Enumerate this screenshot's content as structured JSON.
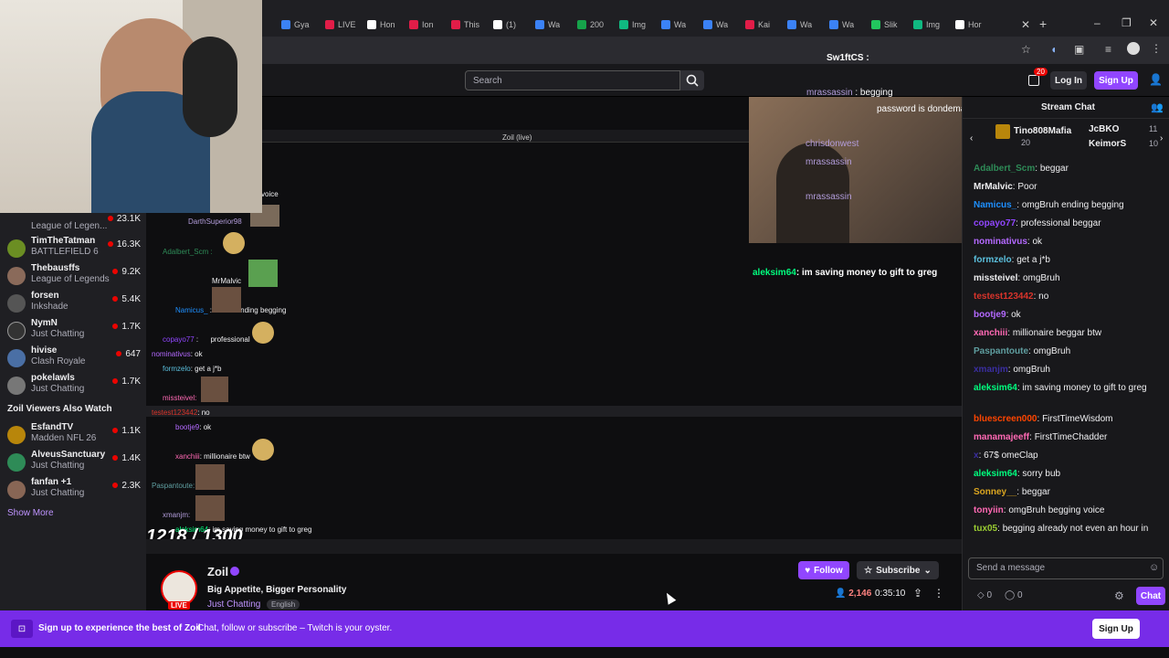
{
  "browser": {
    "tabs": [
      "Gya",
      "LIVE",
      "Hon",
      "Ion",
      "This",
      "(1)",
      "Wa",
      "200",
      "Img",
      "Wa",
      "Wa",
      "Kai",
      "Wa",
      "Wa",
      "Slik",
      "Img",
      "Hor"
    ]
  },
  "header": {
    "search_placeholder": "Search",
    "notif_count": "20",
    "login_label": "Log In",
    "signup_label": "Sign Up"
  },
  "sidebar": {
    "channels": [
      {
        "name": "TimTheTatman",
        "game": "BATTLEFIELD 6",
        "viewers": "16.3K"
      },
      {
        "name": "Thebausffs",
        "game": "League of Legends",
        "viewers": "9.2K"
      },
      {
        "name": "forsen",
        "game": "Inkshade",
        "viewers": "5.4K"
      },
      {
        "name": "NymN",
        "game": "Just Chatting",
        "viewers": "1.7K"
      },
      {
        "name": "hivise",
        "game": "Clash Royale",
        "viewers": "647"
      },
      {
        "name": "pokelawls",
        "game": "Just Chatting",
        "viewers": "1.7K"
      }
    ],
    "also_watch_title": "Zoil Viewers Also Watch",
    "also_watch": [
      {
        "name": "EsfandTV",
        "game": "Madden NFL 26",
        "viewers": "1.1K"
      },
      {
        "name": "AlveusSanctuary",
        "game": "Just Chatting",
        "viewers": "1.4K"
      },
      {
        "name": "fanfan +1",
        "game": "Just Chatting",
        "viewers": "2.3K"
      }
    ],
    "top_partial": {
      "game": "League of Legen...",
      "viewers": "23.1K"
    },
    "show_more": "Show More"
  },
  "player": {
    "window_title": "Zoil (live)",
    "counter": "1218 / 1300",
    "overlay_chat": [
      {
        "user": "Sw1ftCS",
        "text": ":"
      },
      {
        "user": "mrassassin",
        "text": "begging"
      },
      {
        "user": "",
        "text": "password is dondemarco1994"
      },
      {
        "user": "chrisdonwest",
        "text": ""
      },
      {
        "user": "mrassassin",
        "text": ""
      },
      {
        "user": "mrassassin",
        "text": ""
      },
      {
        "user": "aleksim64",
        "text": "im saving money to gift to greg"
      }
    ],
    "inner_chat": [
      {
        "user": "DarthSuperior98",
        "text": ""
      },
      {
        "user": "Adalbert_Scm",
        "text": ""
      },
      {
        "user": "MrMalvic",
        "text": ""
      },
      {
        "user": "Namicus_",
        "text": "ending begging"
      },
      {
        "user": "copayo77",
        "text": "professional"
      },
      {
        "user": "nominativus",
        "text": "ok"
      },
      {
        "user": "formzelo",
        "text": "get a j*b"
      },
      {
        "user": "missteivel",
        "text": ""
      },
      {
        "user": "testest123442",
        "text": "no"
      },
      {
        "user": "bootje9",
        "text": "ok"
      },
      {
        "user": "xanchiii",
        "text": "millionaire       btw"
      },
      {
        "user": "Paspantoute",
        "text": ""
      },
      {
        "user": "xmanjm",
        "text": ""
      },
      {
        "user": "aleksim64",
        "text": "im saving money to gift to greg"
      }
    ],
    "inner_voice": "voice"
  },
  "stream": {
    "name": "Zoil",
    "title": "Big Appetite, Bigger Personality",
    "category": "Just Chatting",
    "tag": "English",
    "live_label": "LIVE",
    "follow_label": "Follow",
    "subscribe_label": "Subscribe",
    "viewers": "2,146",
    "uptime": "0:35:10"
  },
  "chat": {
    "title": "Stream Chat",
    "gifters": [
      {
        "name": "Tino808Mafia",
        "count": "20"
      },
      {
        "name": "JcBKO",
        "count": "11"
      },
      {
        "name": "KeimorS",
        "count": "10"
      }
    ],
    "messages": [
      {
        "user": "Adalbert_Scm",
        "text": "beggar",
        "color": "#2e8b57"
      },
      {
        "user": "MrMalvic",
        "text": "Poor",
        "color": "#efeff1"
      },
      {
        "user": "Namicus_",
        "text": "omgBruh ending begging",
        "color": "#1e90ff"
      },
      {
        "user": "copayo77",
        "text": "professional beggar",
        "color": "#9146ff"
      },
      {
        "user": "nominativus",
        "text": "ok",
        "color": "#b469ff"
      },
      {
        "user": "formzelo",
        "text": "get a j*b",
        "color": "#5bc0de"
      },
      {
        "user": "missteivel",
        "text": "omgBruh",
        "color": "#efeff1"
      },
      {
        "user": "testest123442",
        "text": "no",
        "color": "#d9342b"
      },
      {
        "user": "bootje9",
        "text": "ok",
        "color": "#b469ff"
      },
      {
        "user": "xanchiii",
        "text": "millionaire beggar btw",
        "color": "#ff69b4"
      },
      {
        "user": "Paspantoute",
        "text": "omgBruh",
        "color": "#5f9ea0"
      },
      {
        "user": "xmanjm",
        "text": "omgBruh",
        "color": "#3a2ea0"
      },
      {
        "user": "aleksim64",
        "text": "im saving money to gift to greg",
        "color": "#00ff7f"
      },
      {
        "user": "bluescreen000",
        "text": "FirstTimeWisdom",
        "color": "#ff4500"
      },
      {
        "user": "manamajeeff",
        "text": "FirstTimeChadder",
        "color": "#ff69b4"
      },
      {
        "user": "x",
        "text": "67$ omeClap",
        "color": "#3a2ea0"
      },
      {
        "user": "aleksim64",
        "text": "sorry bub",
        "color": "#00ff7f"
      },
      {
        "user": "Sonney__",
        "text": "beggar",
        "color": "#daa520"
      },
      {
        "user": "tonyiin",
        "text": "omgBruh begging voice",
        "color": "#ff69b4"
      },
      {
        "user": "tux05",
        "text": "begging already not even an hour in",
        "color": "#9acd32"
      }
    ],
    "input_placeholder": "Send a message",
    "points_a": "0",
    "points_b": "0",
    "chat_button": "Chat"
  },
  "banner": {
    "headline": "Sign up to experience the best of Zoil",
    "sub": "Chat, follow or subscribe – Twitch is your oyster.",
    "signup_label": "Sign Up"
  },
  "colors": {
    "accent": "#9146ff",
    "banner": "#772ce8",
    "live": "#eb0400"
  }
}
